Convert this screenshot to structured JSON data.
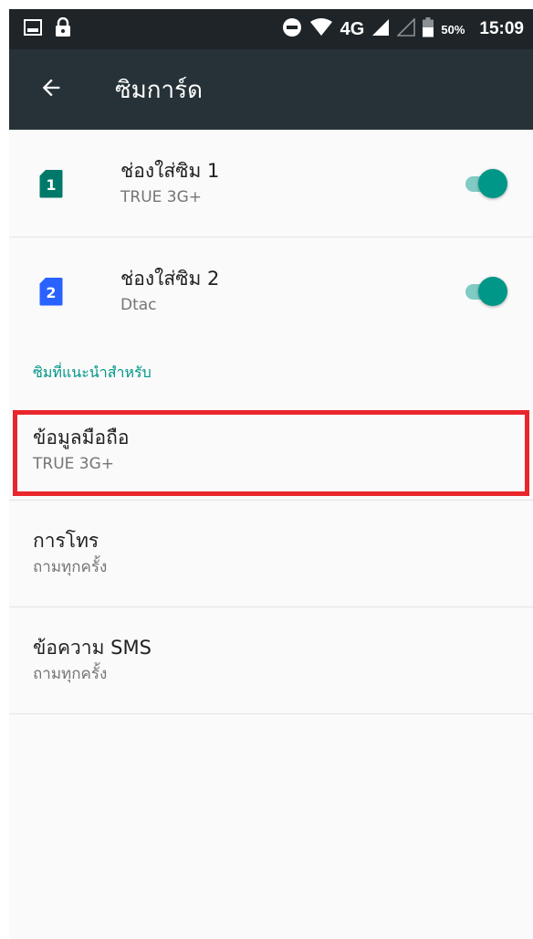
{
  "status_bar": {
    "network": "4G",
    "battery": "50%",
    "time": "15:09",
    "icons": [
      "image-icon",
      "lock-icon",
      "do-not-disturb-icon",
      "wifi-icon",
      "signal-icon",
      "signal-empty-icon",
      "battery-icon"
    ]
  },
  "app_bar": {
    "back_icon": "arrow-back-icon",
    "title": "ซิมการ์ด"
  },
  "sims": [
    {
      "slot_number": "1",
      "title": "ช่องใส่ซิม 1",
      "carrier": "TRUE 3G+",
      "enabled": true,
      "icon_color": "#00796b"
    },
    {
      "slot_number": "2",
      "title": "ช่องใส่ซิม 2",
      "carrier": "Dtac",
      "enabled": true,
      "icon_color": "#2962ff"
    }
  ],
  "preferred_section": {
    "header": "ซิมที่แนะนำสำหรับ",
    "items": [
      {
        "title": "ข้อมูลมือถือ",
        "value": "TRUE 3G+",
        "highlighted": true
      },
      {
        "title": "การโทร",
        "value": "ถามทุกครั้ง"
      },
      {
        "title": "ข้อความ SMS",
        "value": "ถามทุกครั้ง"
      }
    ]
  },
  "colors": {
    "status_bar_bg": "#1e2428",
    "app_bar_bg": "#263238",
    "accent": "#009688",
    "switch_track": "#80cbc4",
    "highlight": "#e8262b"
  }
}
